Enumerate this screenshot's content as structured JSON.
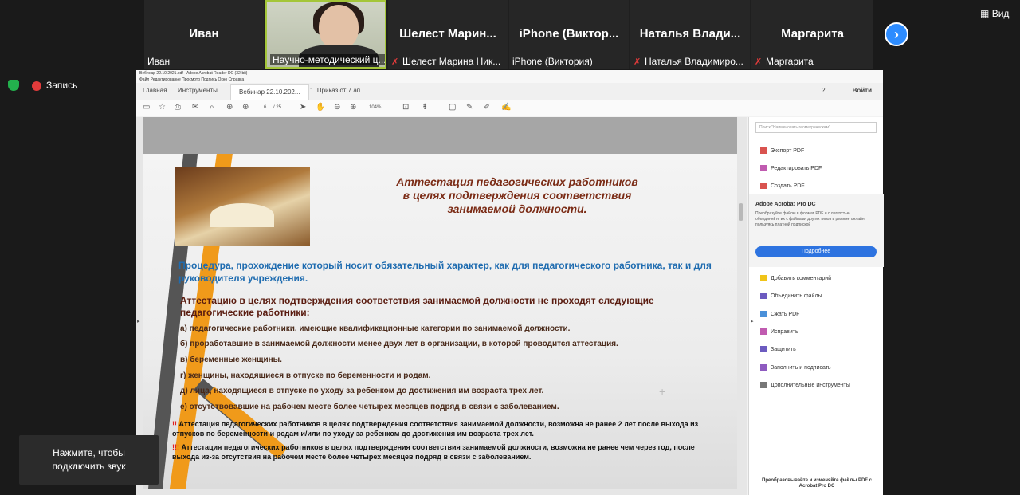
{
  "participants": [
    {
      "big_name": "Иван",
      "label": "Иван",
      "muted": false
    },
    {
      "big_name": "",
      "label": "Научно-методический ц...",
      "muted": false,
      "video": true
    },
    {
      "big_name": "Шелест Марин...",
      "label": "Шелест Марина Ник...",
      "muted": true
    },
    {
      "big_name": "iPhone (Виктор...",
      "label": "iPhone (Виктория)",
      "muted": false
    },
    {
      "big_name": "Наталья Влади...",
      "label": "Наталья Владимиро...",
      "muted": true
    },
    {
      "big_name": "Маргарита",
      "label": "Маргарита",
      "muted": true
    }
  ],
  "view_label": "Вид",
  "recording_label": "Запись",
  "window": {
    "title": "Вебинар 22.10.2021.pdf - Adobe Acrobat Reader DC (32-bit)",
    "menu": "Файл   Редактирование   Просмотр   Подпись   Окно   Справка",
    "tabs": [
      "Главная",
      "Инструменты",
      "Вебинар 22.10.202...",
      "1. Приказ  от 7 ап..."
    ],
    "signin": "Войти",
    "page_current": "6",
    "page_total": "/ 25",
    "zoom": "104%"
  },
  "document": {
    "title_lines": [
      "Аттестация педагогических работников",
      "в целях подтверждения соответствия",
      "занимаемой должности."
    ],
    "blue_para": "Процедура, прохождение который носит обязательный характер, как для педагогического работника, так и для руководителя учреждения.",
    "sub_head": "Аттестацию в целях подтверждения соответствия занимаемой должности не проходят следующие педагогические работники:",
    "items": [
      "а) педагогические работники, имеющие квалификационные категории по занимаемой должности.",
      "б) проработавшие в занимаемой должности менее двух лет в организации, в которой проводится аттестация.",
      "в) беременные женщины.",
      "г) женщины, находящиеся в отпуске по беременности и родам.",
      "д) лица, находящиеся в отпуске по уходу за ребенком до достижения им возраста трех лет.",
      "е) отсутствовавшие на рабочем месте более четырех месяцев подряд в связи с заболеванием."
    ],
    "notes": [
      {
        "mark": "!!",
        "text": "Аттестация педагогических работников в целях подтверждения соответствия занимаемой должности, возможна не ранее 2 лет после выхода из отпусков по беременности и родам и/или по уходу за ребенком до достижения им возраста трех лет."
      },
      {
        "mark": "!!!",
        "text": "Аттестация педагогических работников в целях подтверждения соответствия занимаемой должности, возможна не ранее чем через год, после выхода из-за отсутствия на рабочем месте более четырех месяцев подряд в связи с заболеванием."
      }
    ]
  },
  "right_panel": {
    "search_placeholder": "Поиск \"Наименовать геометрическим\"",
    "tools_top": [
      "Экспорт PDF",
      "Редактировать PDF",
      "Создать PDF"
    ],
    "promo_title": "Adobe Acrobat Pro DC",
    "promo_text": "Преобразуйте файлы в формат PDF и с легкостью объединяйте их с файлами других типов в режиме онлайн, пользуясь платной подпиской",
    "promo_button": "Подробнее",
    "tools_bottom": [
      "Добавить комментарий",
      "Объединить файлы",
      "Сжать PDF",
      "Исправить",
      "Защитить",
      "Заполнить и подписать",
      "Дополнительные инструменты"
    ],
    "footer": "Преобразовывайте и изменяйте файлы PDF с Acrobat Pro DC"
  },
  "tooltip": {
    "line1": "Нажмите, чтобы",
    "line2": "подключить звук"
  },
  "colors": {
    "zoom_blue": "#2d8cff",
    "doc_title": "#7b2c16",
    "doc_blue": "#1f6cb0",
    "acrobat_blue": "#2d73e0",
    "mute_red": "#e23b3b",
    "orange": "#f09a1a"
  }
}
